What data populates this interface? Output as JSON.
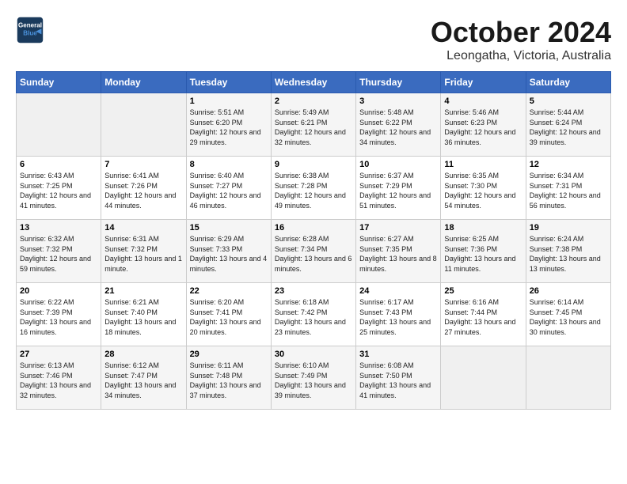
{
  "header": {
    "logo_line1": "General",
    "logo_line2": "Blue",
    "month_title": "October 2024",
    "subtitle": "Leongatha, Victoria, Australia"
  },
  "days_of_week": [
    "Sunday",
    "Monday",
    "Tuesday",
    "Wednesday",
    "Thursday",
    "Friday",
    "Saturday"
  ],
  "weeks": [
    [
      {
        "day": "",
        "info": ""
      },
      {
        "day": "",
        "info": ""
      },
      {
        "day": "1",
        "info": "Sunrise: 5:51 AM\nSunset: 6:20 PM\nDaylight: 12 hours and 29 minutes."
      },
      {
        "day": "2",
        "info": "Sunrise: 5:49 AM\nSunset: 6:21 PM\nDaylight: 12 hours and 32 minutes."
      },
      {
        "day": "3",
        "info": "Sunrise: 5:48 AM\nSunset: 6:22 PM\nDaylight: 12 hours and 34 minutes."
      },
      {
        "day": "4",
        "info": "Sunrise: 5:46 AM\nSunset: 6:23 PM\nDaylight: 12 hours and 36 minutes."
      },
      {
        "day": "5",
        "info": "Sunrise: 5:44 AM\nSunset: 6:24 PM\nDaylight: 12 hours and 39 minutes."
      }
    ],
    [
      {
        "day": "6",
        "info": "Sunrise: 6:43 AM\nSunset: 7:25 PM\nDaylight: 12 hours and 41 minutes."
      },
      {
        "day": "7",
        "info": "Sunrise: 6:41 AM\nSunset: 7:26 PM\nDaylight: 12 hours and 44 minutes."
      },
      {
        "day": "8",
        "info": "Sunrise: 6:40 AM\nSunset: 7:27 PM\nDaylight: 12 hours and 46 minutes."
      },
      {
        "day": "9",
        "info": "Sunrise: 6:38 AM\nSunset: 7:28 PM\nDaylight: 12 hours and 49 minutes."
      },
      {
        "day": "10",
        "info": "Sunrise: 6:37 AM\nSunset: 7:29 PM\nDaylight: 12 hours and 51 minutes."
      },
      {
        "day": "11",
        "info": "Sunrise: 6:35 AM\nSunset: 7:30 PM\nDaylight: 12 hours and 54 minutes."
      },
      {
        "day": "12",
        "info": "Sunrise: 6:34 AM\nSunset: 7:31 PM\nDaylight: 12 hours and 56 minutes."
      }
    ],
    [
      {
        "day": "13",
        "info": "Sunrise: 6:32 AM\nSunset: 7:32 PM\nDaylight: 12 hours and 59 minutes."
      },
      {
        "day": "14",
        "info": "Sunrise: 6:31 AM\nSunset: 7:32 PM\nDaylight: 13 hours and 1 minute."
      },
      {
        "day": "15",
        "info": "Sunrise: 6:29 AM\nSunset: 7:33 PM\nDaylight: 13 hours and 4 minutes."
      },
      {
        "day": "16",
        "info": "Sunrise: 6:28 AM\nSunset: 7:34 PM\nDaylight: 13 hours and 6 minutes."
      },
      {
        "day": "17",
        "info": "Sunrise: 6:27 AM\nSunset: 7:35 PM\nDaylight: 13 hours and 8 minutes."
      },
      {
        "day": "18",
        "info": "Sunrise: 6:25 AM\nSunset: 7:36 PM\nDaylight: 13 hours and 11 minutes."
      },
      {
        "day": "19",
        "info": "Sunrise: 6:24 AM\nSunset: 7:38 PM\nDaylight: 13 hours and 13 minutes."
      }
    ],
    [
      {
        "day": "20",
        "info": "Sunrise: 6:22 AM\nSunset: 7:39 PM\nDaylight: 13 hours and 16 minutes."
      },
      {
        "day": "21",
        "info": "Sunrise: 6:21 AM\nSunset: 7:40 PM\nDaylight: 13 hours and 18 minutes."
      },
      {
        "day": "22",
        "info": "Sunrise: 6:20 AM\nSunset: 7:41 PM\nDaylight: 13 hours and 20 minutes."
      },
      {
        "day": "23",
        "info": "Sunrise: 6:18 AM\nSunset: 7:42 PM\nDaylight: 13 hours and 23 minutes."
      },
      {
        "day": "24",
        "info": "Sunrise: 6:17 AM\nSunset: 7:43 PM\nDaylight: 13 hours and 25 minutes."
      },
      {
        "day": "25",
        "info": "Sunrise: 6:16 AM\nSunset: 7:44 PM\nDaylight: 13 hours and 27 minutes."
      },
      {
        "day": "26",
        "info": "Sunrise: 6:14 AM\nSunset: 7:45 PM\nDaylight: 13 hours and 30 minutes."
      }
    ],
    [
      {
        "day": "27",
        "info": "Sunrise: 6:13 AM\nSunset: 7:46 PM\nDaylight: 13 hours and 32 minutes."
      },
      {
        "day": "28",
        "info": "Sunrise: 6:12 AM\nSunset: 7:47 PM\nDaylight: 13 hours and 34 minutes."
      },
      {
        "day": "29",
        "info": "Sunrise: 6:11 AM\nSunset: 7:48 PM\nDaylight: 13 hours and 37 minutes."
      },
      {
        "day": "30",
        "info": "Sunrise: 6:10 AM\nSunset: 7:49 PM\nDaylight: 13 hours and 39 minutes."
      },
      {
        "day": "31",
        "info": "Sunrise: 6:08 AM\nSunset: 7:50 PM\nDaylight: 13 hours and 41 minutes."
      },
      {
        "day": "",
        "info": ""
      },
      {
        "day": "",
        "info": ""
      }
    ]
  ]
}
